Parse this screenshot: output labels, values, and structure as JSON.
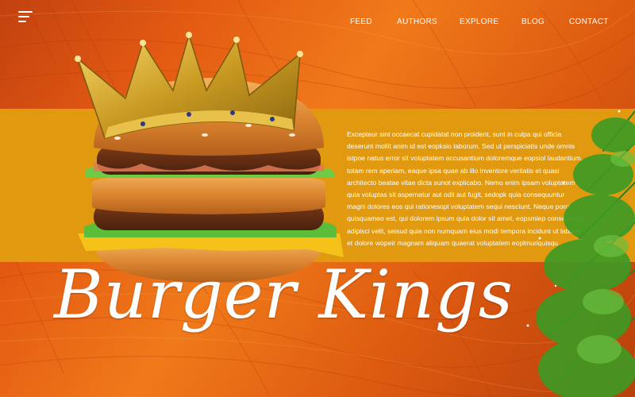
{
  "nav": {
    "items": [
      "FEED",
      "AUTHORS",
      "EXPLORE",
      "BLOG",
      "CONTACT"
    ]
  },
  "hero": {
    "title": "Burger Kings",
    "body": "Excepteur sint occaecat cupidatat non proident, sunt in culpa qui officia deserunt mollit anim id est eopksio laborum. Sed ut perspiciatis unde omnis istpoe natus error sit voluptatem accusantium doloremque eopsiol laudantium, totam rem aperiam, eaque ipsa quae ab illo inventore veritatis et quasi architecto beatae vitae dicta sunot explicabo. Nemo enim ipsam voluptatem quia voluptas sit aspernatur aut odit aut fugit, sedopk quia consequuntur magni dolores eos qui rationesopl voluptatem sequi nesciunt. Neque porro quisquameo est, qui dolorem ipsum quia dolor sit amet, eopsmiep consectetur, adipisci velit, seisud quia non numquam eius modi tempora incidunt ut labore et dolore wopeir magnam aliquam quaerat voluptatem eoplmuriquisqu"
  },
  "icons": {
    "menu": "hamburger-menu-icon"
  },
  "colors": {
    "background": "#e35a12",
    "band": "#e19a10",
    "text": "#ffffff",
    "crown": "#d4a92a"
  }
}
